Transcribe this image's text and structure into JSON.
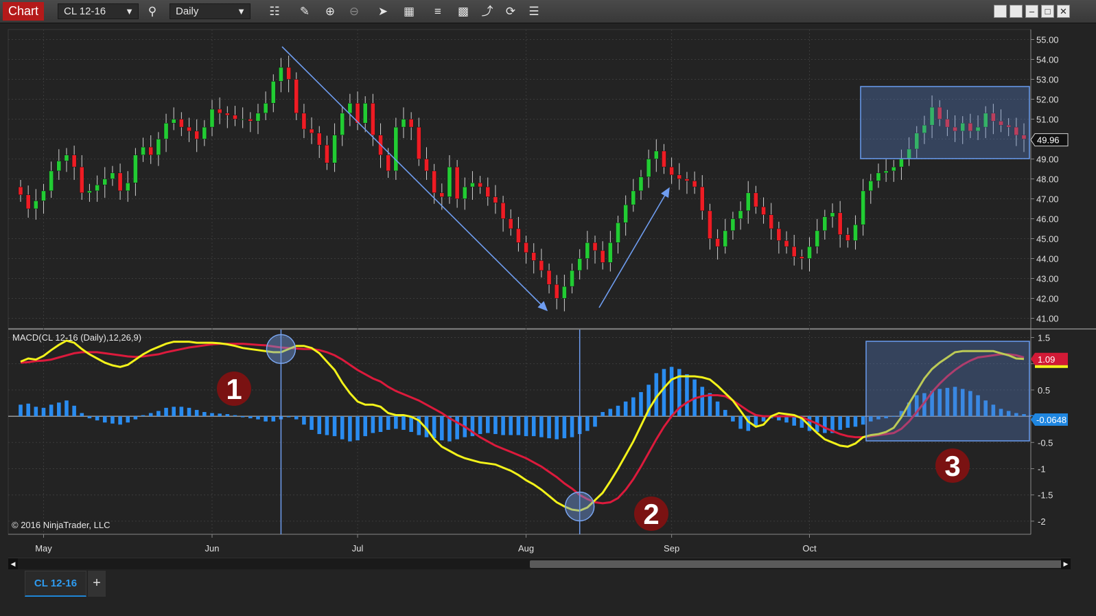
{
  "toolbar": {
    "chart_label": "Chart",
    "instrument": "CL 12-16",
    "interval": "Daily",
    "icons": [
      "magnifier-icon",
      "bar-type-icon",
      "pencil-icon",
      "zoom-in-icon",
      "zoom-out-icon",
      "pointer-icon",
      "data-box-icon",
      "strategies-icon",
      "indicators-icon",
      "drawing-tools-icon",
      "reload-icon",
      "properties-icon"
    ]
  },
  "chart_data": [
    {
      "type": "candlestick",
      "name": "price-panel",
      "y_ticks": [
        "55.00",
        "54.00",
        "53.00",
        "52.00",
        "51.00",
        "50.00",
        "49.00",
        "48.00",
        "47.00",
        "46.00",
        "45.00",
        "44.00",
        "43.00",
        "42.00",
        "41.00"
      ],
      "ylim": [
        40.5,
        55.5
      ],
      "last_price": "49.96",
      "last_price_color": "#ffffff",
      "bull_color": "#22cc33",
      "bear_color": "#ee1c24",
      "closes": [
        47.2,
        46.5,
        46.9,
        47.4,
        48.4,
        48.9,
        49.2,
        48.6,
        47.3,
        47.4,
        47.7,
        48.0,
        48.3,
        47.4,
        47.8,
        49.2,
        49.6,
        49.2,
        50.0,
        50.8,
        51.0,
        50.6,
        50.4,
        50.0,
        50.6,
        51.5,
        51.3,
        51.2,
        51.0,
        51.0,
        50.9,
        51.3,
        51.8,
        52.9,
        53.6,
        53.0,
        51.3,
        50.5,
        50.3,
        49.7,
        48.8,
        50.2,
        51.3,
        51.8,
        50.8,
        51.8,
        50.2,
        49.2,
        48.4,
        50.6,
        51.0,
        50.6,
        49.0,
        48.4,
        47.3,
        47.1,
        48.6,
        47.0,
        47.6,
        47.8,
        47.6,
        47.1,
        46.8,
        46.0,
        45.5,
        44.8,
        44.3,
        43.9,
        43.4,
        42.7,
        42.0,
        42.6,
        43.4,
        44.0,
        44.8,
        44.4,
        43.8,
        44.8,
        45.8,
        46.7,
        47.4,
        48.1,
        49.0,
        49.4,
        48.6,
        48.2,
        48.0,
        47.9,
        47.6,
        46.4,
        45.0,
        44.6,
        45.4,
        46.0,
        46.4,
        47.3,
        46.6,
        46.2,
        45.5,
        44.9,
        44.6,
        44.1,
        44.0,
        44.6,
        45.4,
        46.1,
        46.3,
        45.2,
        44.9,
        45.7,
        47.4,
        47.9,
        48.3,
        48.4,
        48.6,
        49.0,
        49.5,
        50.3,
        50.7,
        51.6,
        51.0,
        50.6,
        50.4,
        50.8,
        50.4,
        50.6,
        51.3,
        50.9,
        50.7,
        50.6,
        50.2,
        50.0
      ]
    },
    {
      "type": "macd",
      "name": "macd-panel",
      "label": "MACD(CL 12-16 (Daily),12,26,9)",
      "y_ticks": [
        "1.5",
        "1",
        "0.5",
        "0",
        "-0.5",
        "-1",
        "-1.5",
        "-2"
      ],
      "ylim": [
        -2.25,
        1.65
      ],
      "macd_value": "1.09",
      "hist_value": "-0.0648",
      "macd_color": "#f2f21a",
      "signal_color": "#dc1a3c",
      "hist_color": "#2a8cf0",
      "macd_line": [
        1.04,
        1.1,
        1.08,
        1.15,
        1.26,
        1.36,
        1.44,
        1.4,
        1.28,
        1.18,
        1.1,
        1.02,
        0.97,
        0.94,
        0.98,
        1.08,
        1.18,
        1.26,
        1.32,
        1.38,
        1.42,
        1.42,
        1.42,
        1.4,
        1.4,
        1.4,
        1.39,
        1.37,
        1.34,
        1.3,
        1.28,
        1.26,
        1.24,
        1.22,
        1.22,
        1.28,
        1.34,
        1.34,
        1.3,
        1.2,
        1.04,
        0.88,
        0.64,
        0.44,
        0.28,
        0.22,
        0.22,
        0.18,
        0.06,
        0.02,
        0.02,
        -0.01,
        -0.08,
        -0.24,
        -0.44,
        -0.58,
        -0.66,
        -0.74,
        -0.8,
        -0.84,
        -0.88,
        -0.9,
        -0.92,
        -0.98,
        -1.04,
        -1.12,
        -1.22,
        -1.3,
        -1.4,
        -1.52,
        -1.64,
        -1.72,
        -1.78,
        -1.8,
        -1.74,
        -1.6,
        -1.46,
        -1.24,
        -1.0,
        -0.74,
        -0.48,
        -0.18,
        0.12,
        0.36,
        0.54,
        0.7,
        0.76,
        0.76,
        0.76,
        0.74,
        0.7,
        0.58,
        0.44,
        0.3,
        0.1,
        -0.1,
        -0.2,
        -0.16,
        0.0,
        0.06,
        0.04,
        0.02,
        -0.04,
        -0.18,
        -0.32,
        -0.44,
        -0.5,
        -0.56,
        -0.58,
        -0.52,
        -0.4,
        -0.36,
        -0.34,
        -0.3,
        -0.22,
        -0.02,
        0.24,
        0.48,
        0.72,
        0.9,
        1.02,
        1.12,
        1.22,
        1.24,
        1.24,
        1.24,
        1.24,
        1.24,
        1.2,
        1.16,
        1.1,
        1.09
      ],
      "signal_line": [
        1.02,
        1.03,
        1.05,
        1.06,
        1.08,
        1.12,
        1.16,
        1.2,
        1.22,
        1.22,
        1.22,
        1.2,
        1.18,
        1.16,
        1.14,
        1.13,
        1.14,
        1.16,
        1.18,
        1.22,
        1.25,
        1.28,
        1.31,
        1.33,
        1.35,
        1.37,
        1.38,
        1.38,
        1.38,
        1.38,
        1.37,
        1.36,
        1.35,
        1.33,
        1.31,
        1.3,
        1.29,
        1.28,
        1.28,
        1.26,
        1.22,
        1.16,
        1.08,
        0.98,
        0.88,
        0.8,
        0.72,
        0.66,
        0.56,
        0.48,
        0.42,
        0.36,
        0.3,
        0.22,
        0.14,
        0.06,
        -0.04,
        -0.12,
        -0.2,
        -0.3,
        -0.4,
        -0.48,
        -0.56,
        -0.62,
        -0.68,
        -0.74,
        -0.8,
        -0.88,
        -0.96,
        -1.06,
        -1.16,
        -1.28,
        -1.38,
        -1.5,
        -1.58,
        -1.64,
        -1.66,
        -1.64,
        -1.56,
        -1.4,
        -1.2,
        -0.96,
        -0.7,
        -0.44,
        -0.2,
        0.0,
        0.16,
        0.26,
        0.34,
        0.38,
        0.4,
        0.4,
        0.38,
        0.3,
        0.2,
        0.1,
        0.02,
        0.0,
        0.0,
        0.0,
        0.0,
        0.0,
        -0.02,
        -0.08,
        -0.14,
        -0.22,
        -0.28,
        -0.34,
        -0.38,
        -0.4,
        -0.4,
        -0.38,
        -0.36,
        -0.34,
        -0.32,
        -0.24,
        -0.1,
        0.08,
        0.26,
        0.46,
        0.62,
        0.76,
        0.88,
        0.98,
        1.06,
        1.12,
        1.14,
        1.16,
        1.18,
        1.18,
        1.16,
        1.12
      ],
      "histogram": [
        0.22,
        0.24,
        0.18,
        0.16,
        0.22,
        0.26,
        0.3,
        0.2,
        0.06,
        -0.04,
        -0.08,
        -0.12,
        -0.14,
        -0.16,
        -0.12,
        -0.06,
        0.02,
        0.06,
        0.1,
        0.16,
        0.18,
        0.18,
        0.16,
        0.12,
        0.08,
        0.06,
        0.05,
        0.04,
        0.02,
        -0.02,
        -0.04,
        -0.06,
        -0.1,
        -0.1,
        -0.06,
        -0.02,
        -0.06,
        -0.16,
        -0.26,
        -0.34,
        -0.36,
        -0.38,
        -0.44,
        -0.48,
        -0.46,
        -0.38,
        -0.32,
        -0.3,
        -0.26,
        -0.24,
        -0.26,
        -0.3,
        -0.36,
        -0.4,
        -0.42,
        -0.46,
        -0.48,
        -0.44,
        -0.4,
        -0.38,
        -0.34,
        -0.32,
        -0.34,
        -0.36,
        -0.36,
        -0.36,
        -0.38,
        -0.38,
        -0.4,
        -0.42,
        -0.44,
        -0.42,
        -0.4,
        -0.34,
        -0.28,
        -0.2,
        0.08,
        0.14,
        0.2,
        0.28,
        0.36,
        0.46,
        0.6,
        0.82,
        0.9,
        0.94,
        0.9,
        0.8,
        0.7,
        0.56,
        0.44,
        0.28,
        0.12,
        -0.1,
        -0.24,
        -0.28,
        -0.2,
        -0.1,
        -0.04,
        -0.08,
        -0.12,
        -0.18,
        -0.22,
        -0.28,
        -0.3,
        -0.32,
        -0.32,
        -0.26,
        -0.22,
        -0.2,
        -0.16,
        -0.1,
        -0.06,
        -0.04,
        0.0,
        0.1,
        0.26,
        0.4,
        0.44,
        0.48,
        0.52,
        0.54,
        0.56,
        0.52,
        0.48,
        0.4,
        0.3,
        0.22,
        0.14,
        0.1,
        0.06,
        0.04,
        0.02,
        -0.0648
      ]
    }
  ],
  "x_axis": {
    "labels": [
      "May",
      "Jun",
      "Jul",
      "Aug",
      "Sep",
      "Oct"
    ]
  },
  "annotations": {
    "markers": [
      "1",
      "2",
      "3"
    ],
    "copyright": "© 2016 NinjaTrader, LLC"
  },
  "tabs": [
    {
      "label": "CL 12-16"
    }
  ],
  "add_tab_label": "+"
}
